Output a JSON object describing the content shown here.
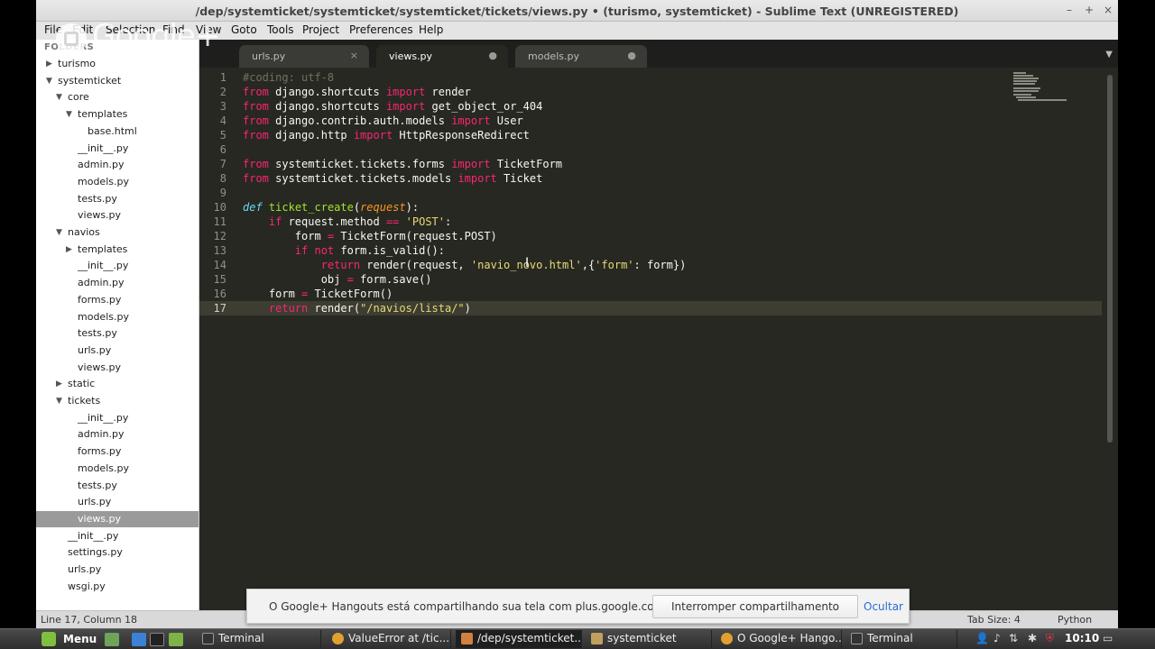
{
  "window": {
    "title": "/dep/systemticket/systemticket/systemticket/tickets/views.py • (turismo, systemticket) - Sublime Text (UNREGISTERED)",
    "controls": {
      "minimize": "–",
      "maximize": "+",
      "close": "×"
    }
  },
  "menubar": [
    "File",
    "Edit",
    "Selection",
    "Find",
    "View",
    "Goto",
    "Tools",
    "Project",
    "Preferences",
    "Help"
  ],
  "overlay_logo": {
    "text": "Google+"
  },
  "sidebar": {
    "header": "FOLDERS",
    "tree": [
      {
        "label": "turismo",
        "arrow": "▶"
      },
      {
        "label": "systemticket",
        "arrow": "▼"
      },
      {
        "label": "core",
        "arrow": "▼"
      },
      {
        "label": "templates",
        "arrow": "▼"
      },
      {
        "label": "base.html",
        "arrow": ""
      },
      {
        "label": "__init__.py",
        "arrow": ""
      },
      {
        "label": "admin.py",
        "arrow": ""
      },
      {
        "label": "models.py",
        "arrow": ""
      },
      {
        "label": "tests.py",
        "arrow": ""
      },
      {
        "label": "views.py",
        "arrow": ""
      },
      {
        "label": "navios",
        "arrow": "▼"
      },
      {
        "label": "templates",
        "arrow": "▶"
      },
      {
        "label": "__init__.py",
        "arrow": ""
      },
      {
        "label": "admin.py",
        "arrow": ""
      },
      {
        "label": "forms.py",
        "arrow": ""
      },
      {
        "label": "models.py",
        "arrow": ""
      },
      {
        "label": "tests.py",
        "arrow": ""
      },
      {
        "label": "urls.py",
        "arrow": ""
      },
      {
        "label": "views.py",
        "arrow": ""
      },
      {
        "label": "static",
        "arrow": "▶"
      },
      {
        "label": "tickets",
        "arrow": "▼"
      },
      {
        "label": "__init__.py",
        "arrow": ""
      },
      {
        "label": "admin.py",
        "arrow": ""
      },
      {
        "label": "forms.py",
        "arrow": ""
      },
      {
        "label": "models.py",
        "arrow": ""
      },
      {
        "label": "tests.py",
        "arrow": ""
      },
      {
        "label": "urls.py",
        "arrow": ""
      },
      {
        "label": "views.py",
        "arrow": ""
      },
      {
        "label": "__init__.py",
        "arrow": ""
      },
      {
        "label": "settings.py",
        "arrow": ""
      },
      {
        "label": "urls.py",
        "arrow": ""
      },
      {
        "label": "wsgi.py",
        "arrow": ""
      }
    ]
  },
  "tabs": [
    {
      "label": "urls.py",
      "close": "×"
    },
    {
      "label": "views.py",
      "close": "●"
    },
    {
      "label": "models.py",
      "close": "●"
    }
  ],
  "tab_menu_icon": "▼",
  "editor": {
    "line_numbers": [
      "1",
      "2",
      "3",
      "4",
      "5",
      "6",
      "7",
      "8",
      "9",
      "10",
      "11",
      "12",
      "13",
      "14",
      "15",
      "16",
      "17"
    ]
  },
  "statusbar": {
    "position": "Line 17, Column 18",
    "tab_size": "Tab Size: 4",
    "syntax": "Python"
  },
  "hangouts": {
    "message": "O Google+ Hangouts está compartilhando sua tela com plus.google.com.",
    "stop_button": "Interromper compartilhamento",
    "hide_link": "Ocultar"
  },
  "taskbar": {
    "menu_label": "Menu",
    "tasks": [
      {
        "label": "Terminal",
        "color": "#333333"
      },
      {
        "label": "ValueError at /tic...",
        "color": "#e0a030"
      },
      {
        "label": "/dep/systemticket...",
        "color": "#d08040"
      },
      {
        "label": "systemticket",
        "color": "#c0a060"
      },
      {
        "label": "O Google+ Hango...",
        "color": "#e0a030"
      },
      {
        "label": "Terminal",
        "color": "#333333"
      }
    ],
    "clock": "10:10"
  }
}
